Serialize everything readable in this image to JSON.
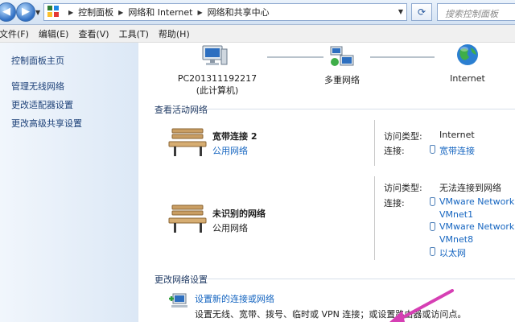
{
  "address_bar": {
    "crumbs": [
      "控制面板",
      "网络和 Internet",
      "网络和共享中心"
    ],
    "search_placeholder": "搜索控制面板"
  },
  "menu": [
    "文件(F)",
    "编辑(E)",
    "查看(V)",
    "工具(T)",
    "帮助(H)"
  ],
  "sidebar": {
    "items": [
      {
        "label": "控制面板主页"
      },
      {
        "label": "管理无线网络"
      },
      {
        "label": "更改适配器设置"
      },
      {
        "label": "更改高级共享设置"
      }
    ]
  },
  "network_map": {
    "computer_name": "PC201311192217",
    "computer_sub": "(此计算机)",
    "middle": "多重网络",
    "internet": "Internet"
  },
  "active_networks": {
    "title": "查看活动网络",
    "networks": [
      {
        "name": "宽带连接  2",
        "type": "公用网络",
        "access_label": "访问类型:",
        "access_value": "Internet",
        "conn_label": "连接:",
        "connections": [
          "宽带连接"
        ]
      },
      {
        "name": "未识别的网络",
        "type": "公用网络",
        "access_label": "访问类型:",
        "access_value": "无法连接到网络",
        "conn_label": "连接:",
        "connections": [
          "VMware Network",
          "VMnet1",
          "VMware Network",
          "VMnet8",
          "以太网"
        ]
      }
    ]
  },
  "change_settings": {
    "title": "更改网络设置",
    "new_conn_link": "设置新的连接或网络",
    "new_conn_desc": "设置无线、宽带、拨号、临时或 VPN 连接；或设置路由器或访问点。"
  },
  "colors": {
    "link": "#1565c0",
    "sidebar_link": "#1b3f77",
    "arrow": "#d63fb4"
  }
}
